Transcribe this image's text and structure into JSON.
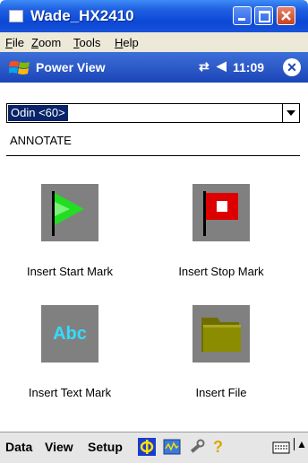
{
  "window": {
    "title": "Wade_HX2410"
  },
  "menu": {
    "file": "File",
    "zoom": "Zoom",
    "tools": "Tools",
    "help": "Help"
  },
  "app_bar": {
    "title": "Power View",
    "time": "11:09"
  },
  "device_select": {
    "selected": "Odin <60>"
  },
  "section_title": "ANNOTATE",
  "actions": [
    {
      "label": "Insert Start Mark",
      "icon": "green-flag-icon"
    },
    {
      "label": "Insert Stop Mark",
      "icon": "red-flag-icon"
    },
    {
      "label": "Insert Text Mark",
      "icon": "abc-text-icon",
      "icon_text": "Abc"
    },
    {
      "label": "Insert File",
      "icon": "folder-icon"
    }
  ],
  "bottom_menu": {
    "data": "Data",
    "view": "View",
    "setup": "Setup"
  },
  "colors": {
    "accent_blue": "#1f5fe0",
    "start_green": "#22dd22",
    "stop_red": "#dd0000",
    "abc_cyan": "#33ddff",
    "folder_olive": "#8c8c00"
  }
}
